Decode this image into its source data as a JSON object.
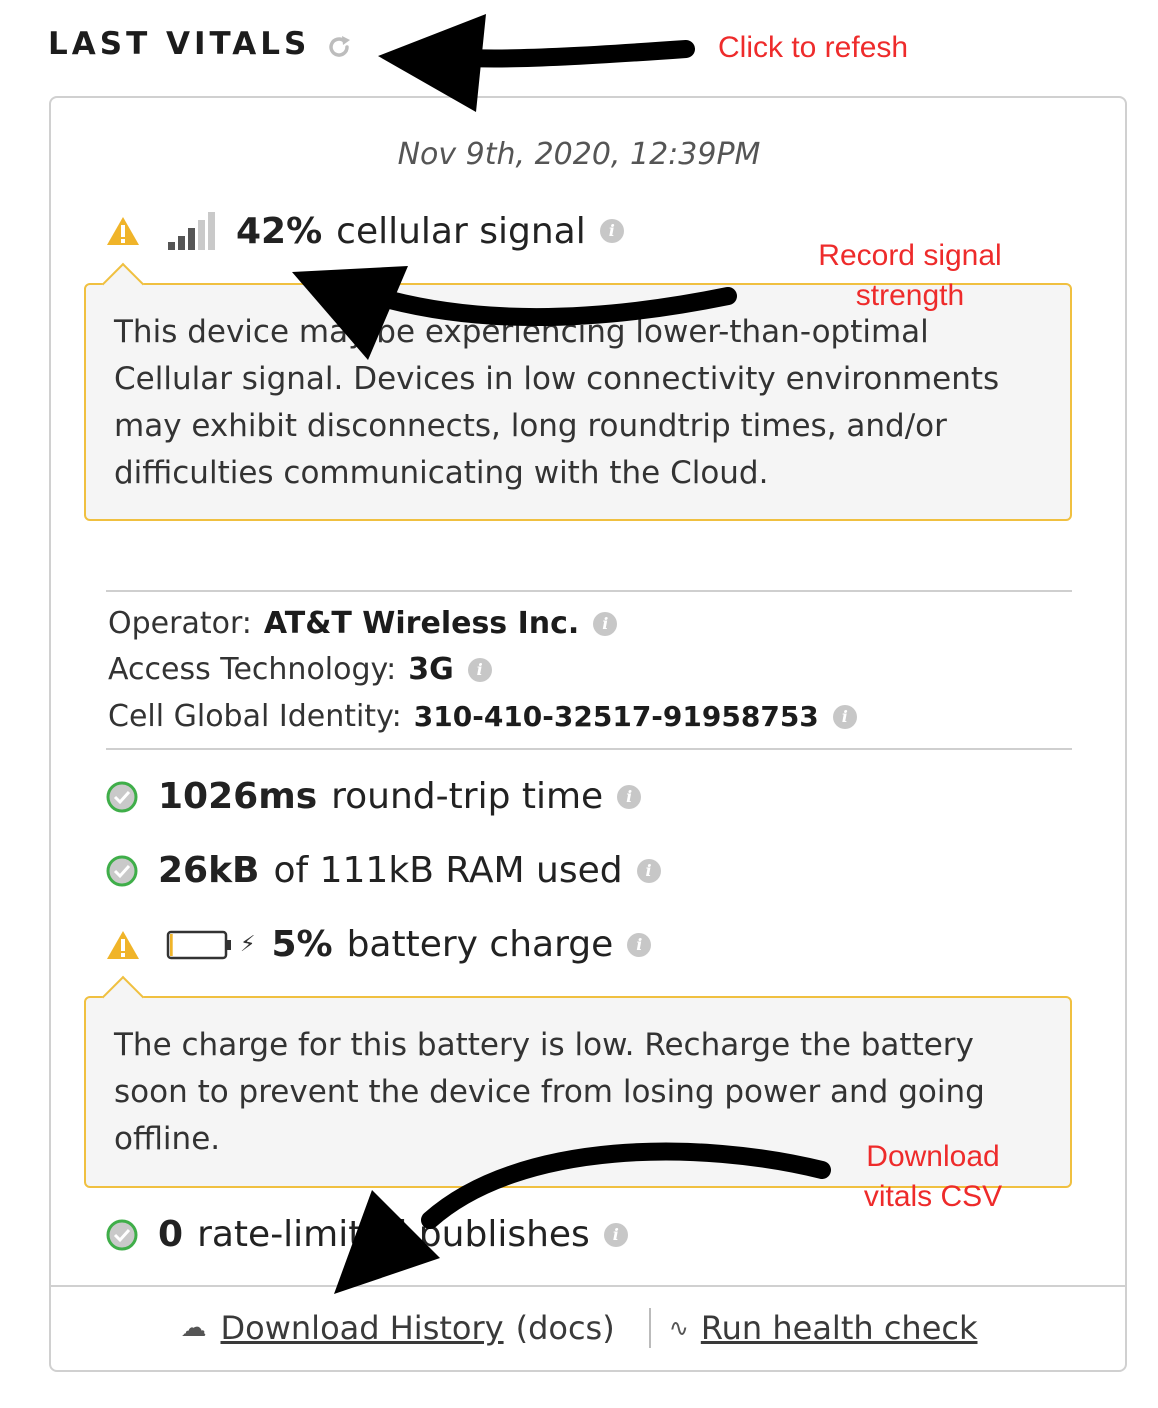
{
  "header": {
    "title": "LAST VITALS",
    "refresh_icon": "refresh-icon"
  },
  "timestamp": "Nov 9th, 2020, 12:39PM",
  "signal": {
    "value": "42%",
    "label": "cellular signal",
    "icon": "signal-bars-icon",
    "strength_fraction": 0.42,
    "warning": "This device may be experiencing lower-than-optimal Cellular signal. Devices in low connectivity environments may exhibit disconnects, long roundtrip times, and/or difficulties communicating with the Cloud."
  },
  "network": {
    "operator_label": "Operator:",
    "operator_value": "AT&T Wireless Inc.",
    "access_label": "Access Technology:",
    "access_value": "3G",
    "cgi_label": "Cell Global Identity:",
    "cgi_value": "310-410-32517-91958753"
  },
  "rtt": {
    "value": "1026ms",
    "label": "round-trip time"
  },
  "ram": {
    "value": "26kB",
    "label": "of 111kB RAM used"
  },
  "battery": {
    "value": "5%",
    "label": "battery charge",
    "charge_fraction": 0.05,
    "warning": "The charge for this battery is low. Recharge the battery soon to prevent the device from losing power and going offline."
  },
  "publishes": {
    "value": "0",
    "label": "rate-limited publishes"
  },
  "footer": {
    "download_label": "Download History",
    "docs_label": "(docs)",
    "health_label": "Run health check"
  },
  "annotations": {
    "refresh": "Click to refesh",
    "signal": "Record signal strength",
    "download": "Download vitals CSV"
  },
  "colors": {
    "warning": "#f0b429",
    "ok": "#3fae49",
    "annotation": "#ee2b2b"
  }
}
